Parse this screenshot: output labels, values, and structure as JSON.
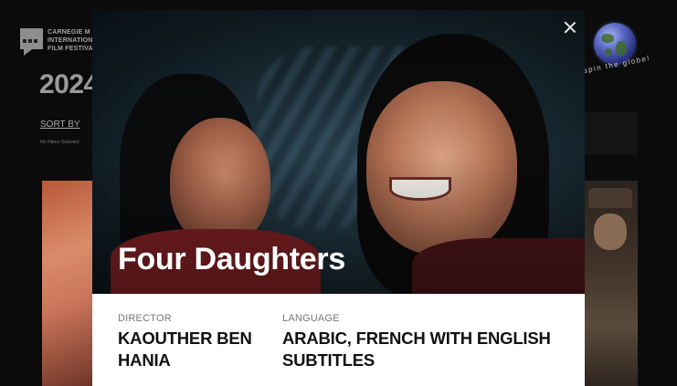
{
  "background": {
    "logo_lines": [
      "CARNEGIE M",
      "INTERNATION",
      "FILM FESTIVA"
    ],
    "year": "2024",
    "sort_by": "SORT BY",
    "no_filters": "No Filters Selected",
    "globe_caption": "spin the globe!"
  },
  "modal": {
    "title": "Four Daughters",
    "director": {
      "label": "DIRECTOR",
      "value": "KAOUTHER BEN HANIA"
    },
    "language": {
      "label": "LANGUAGE",
      "value": "ARABIC, FRENCH WITH ENGLISH SUBTITLES"
    }
  }
}
